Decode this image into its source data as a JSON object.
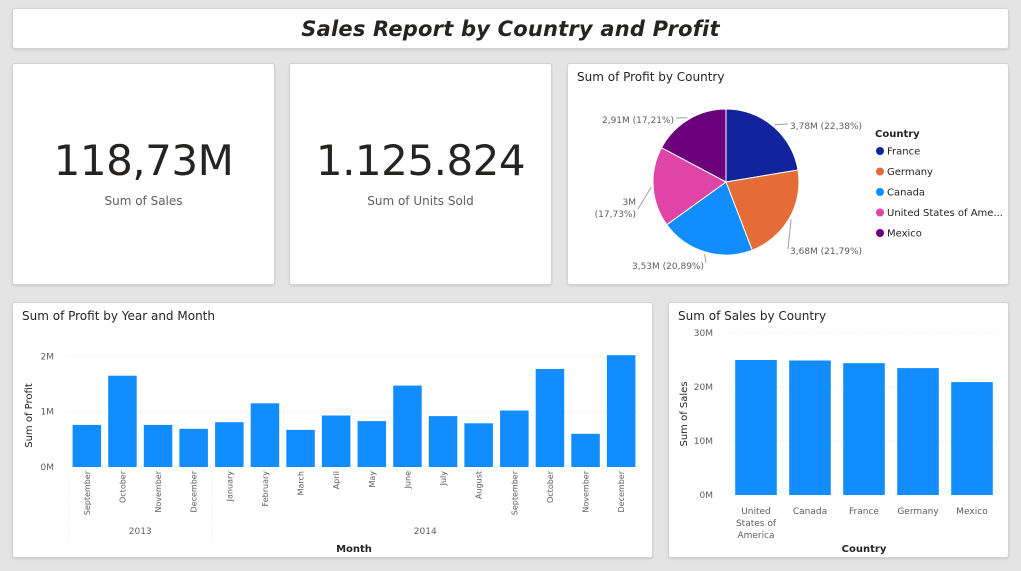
{
  "header": {
    "title": "Sales Report by Country and Profit"
  },
  "kpis": {
    "sales": {
      "value": "118,73M",
      "label": "Sum of Sales"
    },
    "units": {
      "value": "1.125.824",
      "label": "Sum of Units Sold"
    }
  },
  "colors": {
    "bar": "#118dff",
    "France": "#12239e",
    "Germany": "#e66c37",
    "Canada": "#118dff",
    "United States of America": "#e044a7",
    "Mexico": "#6b007b"
  },
  "chart_data": [
    {
      "type": "pie",
      "title": "Sum of Profit by Country",
      "legend_title": "Country",
      "legend_position": "right",
      "categories": [
        "France",
        "Germany",
        "Canada",
        "United States of America",
        "Mexico"
      ],
      "legend_labels": [
        "France",
        "Germany",
        "Canada",
        "United States of Ame...",
        "Mexico"
      ],
      "values": [
        22.38,
        21.79,
        20.89,
        17.73,
        17.21
      ],
      "labels": [
        "3,78M (22,38%)",
        "3,68M (21,79%)",
        "3,53M (20,89%)",
        "3M (17,73%)",
        "2,91M (17,21%)"
      ]
    },
    {
      "type": "bar",
      "title": "Sum of Profit by Year and Month",
      "xlabel": "Month",
      "ylabel": "Sum of Profit",
      "yticks": [
        "0M",
        "1M",
        "2M"
      ],
      "ylim": [
        0,
        2.15
      ],
      "grid": true,
      "groups": [
        {
          "name": "2013",
          "count": 4
        },
        {
          "name": "2014",
          "count": 12
        }
      ],
      "categories": [
        "September",
        "October",
        "November",
        "December",
        "January",
        "February",
        "March",
        "April",
        "May",
        "June",
        "July",
        "August",
        "September",
        "October",
        "November",
        "December"
      ],
      "values": [
        0.76,
        1.65,
        0.76,
        0.69,
        0.81,
        1.15,
        0.67,
        0.93,
        0.83,
        1.47,
        0.92,
        0.79,
        1.02,
        1.77,
        0.6,
        2.02
      ]
    },
    {
      "type": "bar",
      "title": "Sum of Sales by Country",
      "xlabel": "Country",
      "ylabel": "Sum of Sales",
      "yticks": [
        "0M",
        "10M",
        "20M",
        "30M"
      ],
      "ylim": [
        0,
        30
      ],
      "grid": true,
      "categories": [
        "United States of America",
        "Canada",
        "France",
        "Germany",
        "Mexico"
      ],
      "values": [
        25.0,
        24.9,
        24.4,
        23.5,
        20.9
      ]
    }
  ]
}
